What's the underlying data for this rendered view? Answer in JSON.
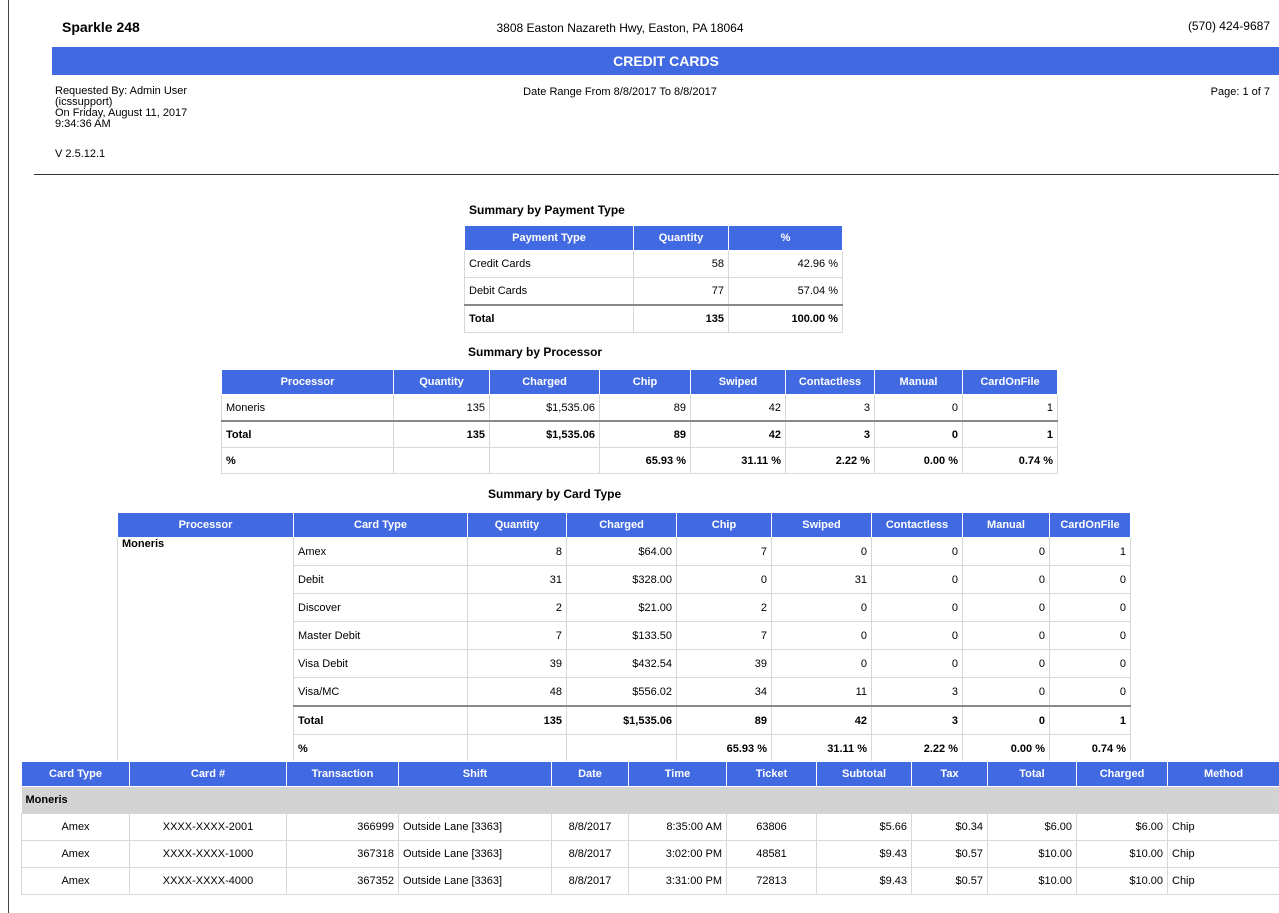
{
  "header": {
    "store_name": "Sparkle  248",
    "address": "3808 Easton Nazareth Hwy, Easton, PA 18064",
    "phone": "(570) 424-9687",
    "report_title": "CREDIT CARDS",
    "requested_by": [
      "Requested By: Admin User",
      "(icssupport)",
      "On Friday, August 11, 2017",
      "9:34:36 AM"
    ],
    "date_range": "Date Range From 8/8/2017 To 8/8/2017",
    "page": "Page: 1 of 7",
    "version": "V 2.5.12.1"
  },
  "payment_type": {
    "caption": "Summary by Payment Type",
    "headers": [
      "Payment Type",
      "Quantity",
      "%"
    ],
    "rows": [
      [
        "Credit Cards",
        "58",
        "42.96 %"
      ],
      [
        "Debit Cards",
        "77",
        "57.04 %"
      ]
    ],
    "total": [
      "Total",
      "135",
      "100.00 %"
    ]
  },
  "processor": {
    "caption": "Summary by Processor",
    "headers": [
      "Processor",
      "Quantity",
      "Charged",
      "Chip",
      "Swiped",
      "Contactless",
      "Manual",
      "CardOnFile"
    ],
    "rows": [
      [
        "Moneris",
        "135",
        "$1,535.06",
        "89",
        "42",
        "3",
        "0",
        "1"
      ]
    ],
    "total": [
      "Total",
      "135",
      "$1,535.06",
      "89",
      "42",
      "3",
      "0",
      "1"
    ],
    "percent": [
      "%",
      "",
      "",
      "65.93 %",
      "31.11 %",
      "2.22 %",
      "0.00 %",
      "0.74 %"
    ]
  },
  "card_type": {
    "caption": "Summary by Card Type",
    "headers": [
      "Processor",
      "Card Type",
      "Quantity",
      "Charged",
      "Chip",
      "Swiped",
      "Contactless",
      "Manual",
      "CardOnFile"
    ],
    "processor_name": "Moneris",
    "rows": [
      [
        "Amex",
        "8",
        "$64.00",
        "7",
        "0",
        "0",
        "0",
        "1"
      ],
      [
        "Debit",
        "31",
        "$328.00",
        "0",
        "31",
        "0",
        "0",
        "0"
      ],
      [
        "Discover",
        "2",
        "$21.00",
        "2",
        "0",
        "0",
        "0",
        "0"
      ],
      [
        "Master Debit",
        "7",
        "$133.50",
        "7",
        "0",
        "0",
        "0",
        "0"
      ],
      [
        "Visa Debit",
        "39",
        "$432.54",
        "39",
        "0",
        "0",
        "0",
        "0"
      ],
      [
        "Visa/MC",
        "48",
        "$556.02",
        "34",
        "11",
        "3",
        "0",
        "0"
      ]
    ],
    "total": [
      "Total",
      "135",
      "$1,535.06",
      "89",
      "42",
      "3",
      "0",
      "1"
    ],
    "percent": [
      "%",
      "",
      "",
      "65.93 %",
      "31.11 %",
      "2.22 %",
      "0.00 %",
      "0.74 %"
    ]
  },
  "detail": {
    "headers": [
      "Card Type",
      "Card #",
      "Transaction",
      "Shift",
      "Date",
      "Time",
      "Ticket",
      "Subtotal",
      "Tax",
      "Total",
      "Charged",
      "Method"
    ],
    "group": "Moneris",
    "rows": [
      [
        "Amex",
        "XXXX-XXXX-2001",
        "366999",
        "Outside Lane [3363]",
        "8/8/2017",
        "8:35:00 AM",
        "63806",
        "$5.66",
        "$0.34",
        "$6.00",
        "$6.00",
        "Chip"
      ],
      [
        "Amex",
        "XXXX-XXXX-1000",
        "367318",
        "Outside Lane [3363]",
        "8/8/2017",
        "3:02:00 PM",
        "48581",
        "$9.43",
        "$0.57",
        "$10.00",
        "$10.00",
        "Chip"
      ],
      [
        "Amex",
        "XXXX-XXXX-4000",
        "367352",
        "Outside Lane [3363]",
        "8/8/2017",
        "3:31:00 PM",
        "72813",
        "$9.43",
        "$0.57",
        "$10.00",
        "$10.00",
        "Chip"
      ]
    ]
  }
}
